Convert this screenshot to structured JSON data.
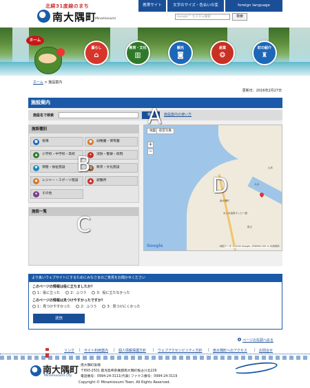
{
  "header": {
    "tagline": "北緯31度線のまち",
    "town_name": "南大隅町",
    "town_name_en": "Minamiosumi",
    "top_links": [
      "携帯サイト",
      "文字のサイズ・色合いの変更",
      "foreign language"
    ],
    "search_placeholder": "Google™ カスタム検索",
    "search_button": "検索"
  },
  "nav": {
    "home": "ホーム",
    "items": [
      {
        "label": "暮らし",
        "icon": "house-icon"
      },
      {
        "label": "教育・文化",
        "icon": "book-icon"
      },
      {
        "label": "観光",
        "icon": "camera-icon"
      },
      {
        "label": "産業",
        "icon": "fish-icon"
      },
      {
        "label": "町の紹介",
        "icon": "lighthouse-icon"
      }
    ]
  },
  "breadcrumb": {
    "home": "ホーム",
    "separator": ">",
    "current": "施設案内"
  },
  "updated": "更新日：2016年2月27日",
  "facility": {
    "title": "施設案内",
    "name_search_label": "施設名で検索",
    "search_button": "検索",
    "help_link": "施設案内の使い方",
    "category_title": "施設種別",
    "categories": [
      {
        "label": "役場",
        "color": "#1d67b8",
        "icon": "building-icon"
      },
      {
        "label": "幼稚園・保育園",
        "color": "#d47a2a",
        "icon": "child-icon"
      },
      {
        "label": "小学校・中学校・高校",
        "color": "#2f7a2a",
        "icon": "school-icon"
      },
      {
        "label": "消防・警察・病院",
        "color": "#c83024",
        "icon": "hospital-icon"
      },
      {
        "label": "保健・福祉施設",
        "color": "#1d8ac0",
        "icon": "heart-icon"
      },
      {
        "label": "教育・文化施設",
        "color": "#8a5a2a",
        "icon": "book-icon"
      },
      {
        "label": "レジャー・スポーツ施設",
        "color": "#d47a2a",
        "icon": "sport-icon"
      },
      {
        "label": "避難所",
        "color": "#c83024",
        "icon": "shelter-icon"
      },
      {
        "label": "その他",
        "color": "#7a3d8a",
        "icon": "star-icon"
      }
    ],
    "list_title": "施設一覧",
    "map": {
      "map_button": "地図",
      "satellite_button": "航空写真",
      "zoom_in": "+",
      "zoom_out": "−",
      "google": "Google",
      "credit": "地図データ ©2016 Google, ZENRIN   200 m   利用規約",
      "labels": [
        "大浜",
        "南大隅町",
        "ねじめ温泉ネッピー館",
        "根占",
        "山本"
      ]
    }
  },
  "overlay_letters": {
    "a": "A",
    "b": "B",
    "c": "C",
    "d": "D"
  },
  "survey": {
    "heading": "より良いウェブサイトにするためにみなさまのご意見をお聞かせください",
    "q1": "このページの情報は役に立ちましたか？",
    "q1_options": [
      "1：役に立った",
      "2：ふつう",
      "3：役に立たなかった"
    ],
    "q2": "このページの情報は見つけやすかったですか？",
    "q2_options": [
      "1：見つけやすかった",
      "2：ふつう",
      "3：見つけにくかった"
    ],
    "submit": "送信"
  },
  "pagetop": "ページの先頭へ戻る",
  "footer": {
    "links": [
      "リンク",
      "サイト利用案内",
      "個人情報保護方針",
      "ウェブアクセシビリティ方針",
      "南大隅町へのアクセス",
      "お問合せ"
    ],
    "town_name": "南大隅町",
    "town_name_en": "Minamiosumi City",
    "office": "南大隅町役場",
    "address": "〒893-2501 鹿児島県肝属郡南大隅町根占川北226",
    "phone": "電話番号：0994-24-3111(代表) ファクス番号：0994-24-3119",
    "copyright": "Copyright © Minamiosumi Town. All Rights Reserved."
  }
}
